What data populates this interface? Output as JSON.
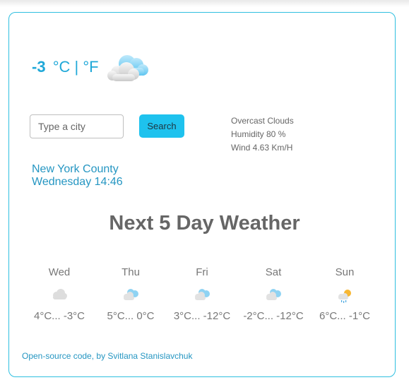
{
  "current": {
    "temperature": "-3",
    "units": "°C | °F",
    "icon": "cloudy-icon"
  },
  "search": {
    "placeholder": "Type a city",
    "button_label": "Search"
  },
  "conditions": {
    "description": "Overcast Clouds",
    "humidity": "Humidity 80 %",
    "wind": "Wind 4.63 Km/H"
  },
  "location": {
    "city": "New York County",
    "datetime": "Wednesday 14:46"
  },
  "forecast": {
    "title": "Next 5 Day Weather",
    "days": [
      {
        "name": "Wed",
        "temps": "4°C... -3°C",
        "icon": "cloud-icon"
      },
      {
        "name": "Thu",
        "temps": "5°C... 0°C",
        "icon": "cloudy-icon"
      },
      {
        "name": "Fri",
        "temps": "3°C... -12°C",
        "icon": "cloudy-icon"
      },
      {
        "name": "Sat",
        "temps": "-2°C... -12°C",
        "icon": "cloudy-icon"
      },
      {
        "name": "Sun",
        "temps": "6°C... -1°C",
        "icon": "sun-cloud-rain-icon"
      }
    ]
  },
  "footer": {
    "link_text": "Open-source code, by Svitlana Stanislavchuk"
  },
  "colors": {
    "accent": "#1fa8d8",
    "button": "#1ec2ee",
    "border": "#2fbfe0",
    "text_gray": "#666666"
  }
}
